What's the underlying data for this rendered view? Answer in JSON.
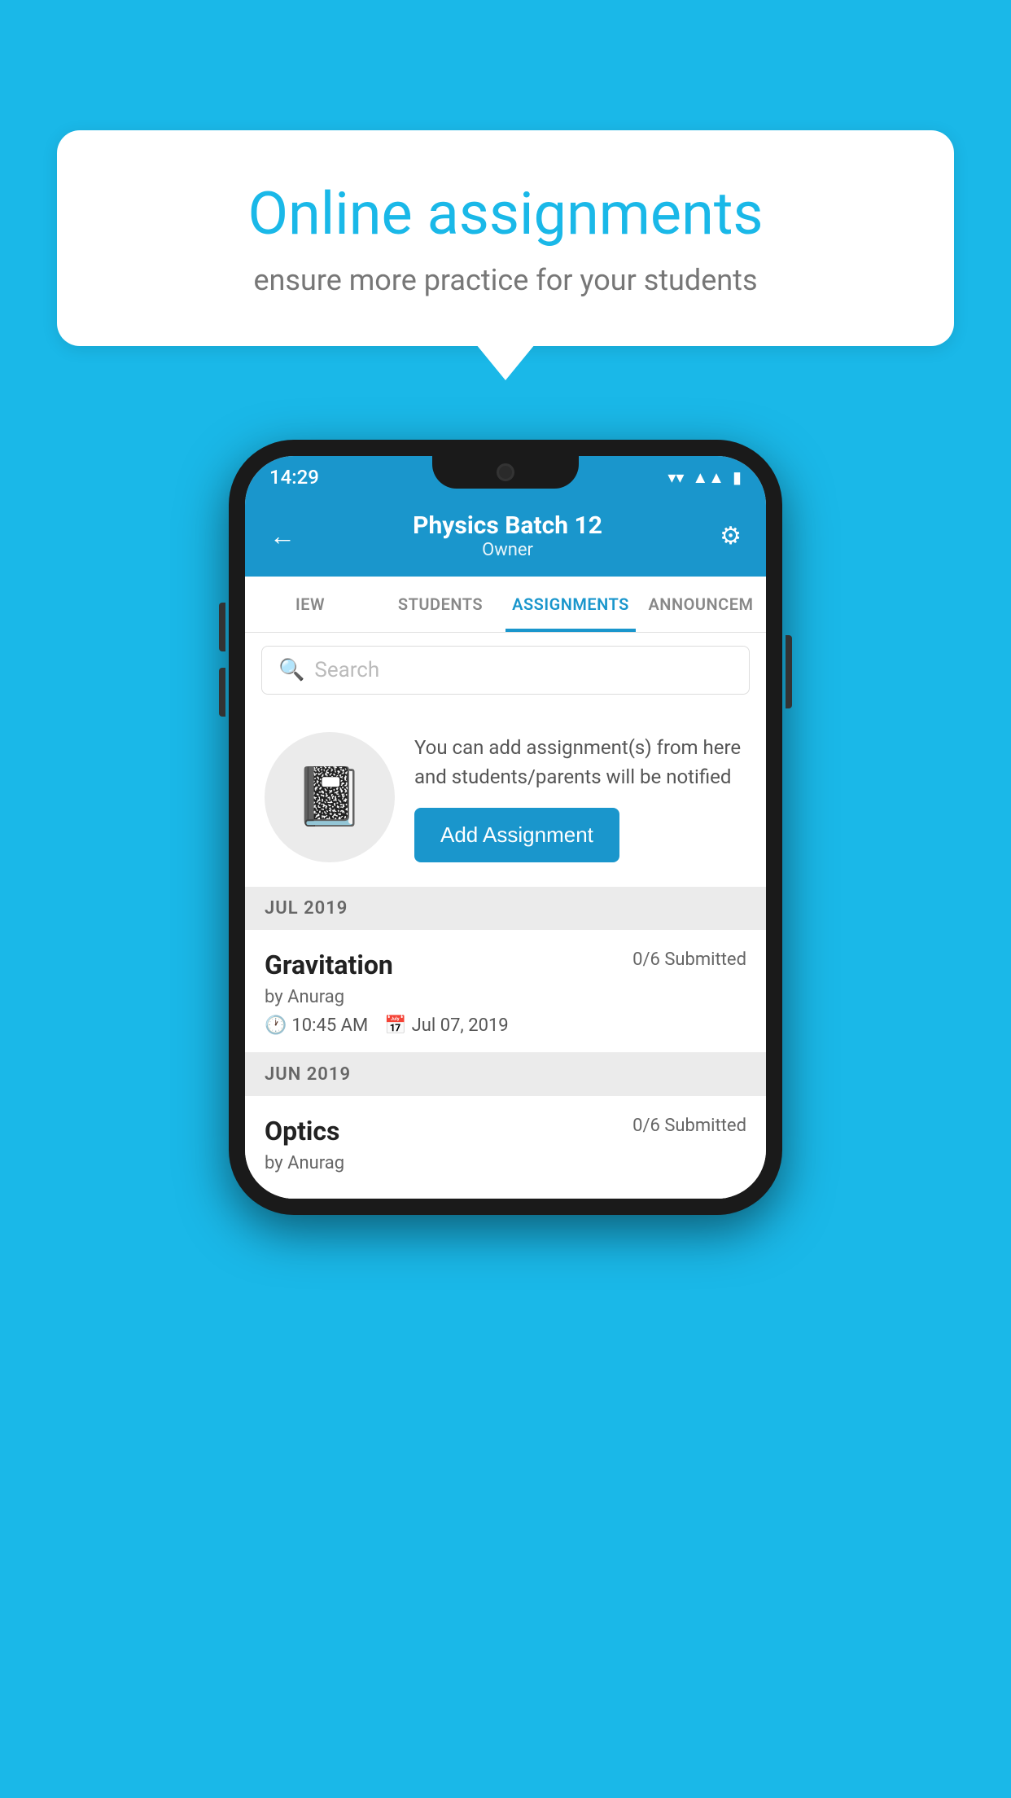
{
  "background_color": "#1ab8e8",
  "speech_bubble": {
    "title": "Online assignments",
    "subtitle": "ensure more practice for your students"
  },
  "phone": {
    "status_bar": {
      "time": "14:29",
      "icons": [
        "wifi",
        "signal",
        "battery"
      ]
    },
    "header": {
      "title": "Physics Batch 12",
      "subtitle": "Owner",
      "back_label": "←",
      "settings_label": "⚙"
    },
    "tabs": [
      {
        "label": "IEW",
        "active": false
      },
      {
        "label": "STUDENTS",
        "active": false
      },
      {
        "label": "ASSIGNMENTS",
        "active": true
      },
      {
        "label": "ANNOUNCEM",
        "active": false
      }
    ],
    "search": {
      "placeholder": "Search"
    },
    "add_assignment_section": {
      "description": "You can add assignment(s) from here and students/parents will be notified",
      "button_label": "Add Assignment"
    },
    "sections": [
      {
        "month": "JUL 2019",
        "assignments": [
          {
            "title": "Gravitation",
            "submitted": "0/6 Submitted",
            "by": "by Anurag",
            "time": "10:45 AM",
            "date": "Jul 07, 2019"
          }
        ]
      },
      {
        "month": "JUN 2019",
        "assignments": [
          {
            "title": "Optics",
            "submitted": "0/6 Submitted",
            "by": "by Anurag",
            "time": "",
            "date": ""
          }
        ]
      }
    ]
  }
}
